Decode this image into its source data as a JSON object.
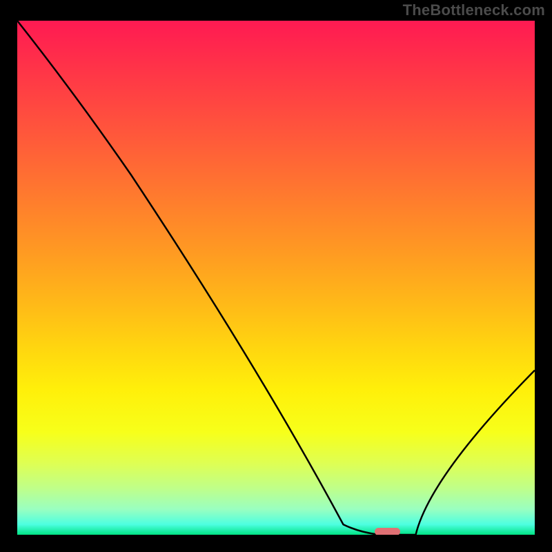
{
  "watermark": "TheBottleneck.com",
  "colors": {
    "frame": "#000000",
    "stroke": "#000000",
    "marker": "#e07074"
  },
  "chart_data": {
    "type": "line",
    "title": "",
    "xlabel": "",
    "ylabel": "",
    "xlim": [
      0,
      100
    ],
    "ylim": [
      0,
      100
    ],
    "x": [
      0,
      22,
      63,
      70,
      77,
      100
    ],
    "values": [
      100,
      70,
      2,
      0,
      0,
      32
    ],
    "marker": {
      "x_center": 71.5,
      "y_center": 0.6,
      "width": 5.0,
      "height": 1.6
    },
    "notes": "V-shaped bottleneck curve over red→green vertical gradient. Values are percentage of chart height from bottom (0 = base line)."
  }
}
